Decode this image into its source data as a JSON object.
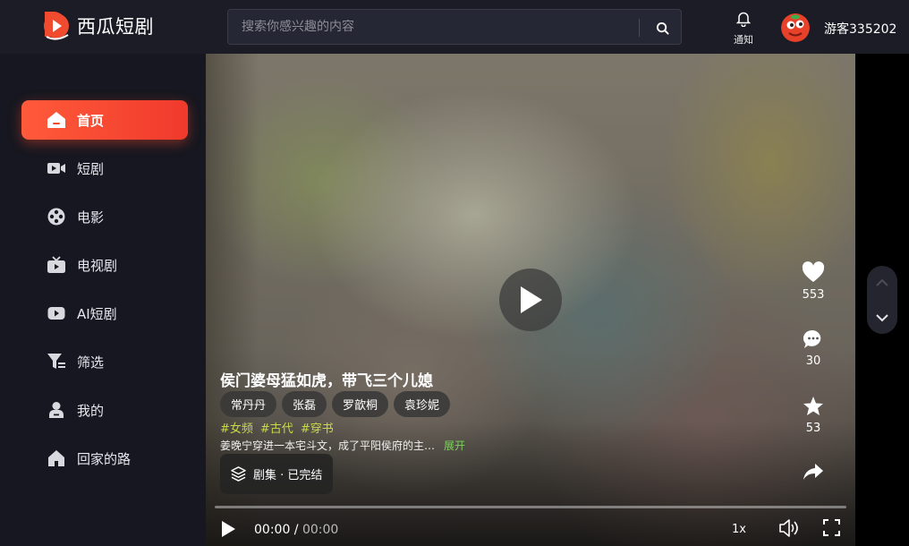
{
  "app": {
    "logo_text": "西瓜短剧"
  },
  "search": {
    "placeholder": "搜索你感兴趣的内容"
  },
  "header": {
    "notify_label": "通知",
    "username": "游客335202"
  },
  "sidebar": {
    "items": [
      {
        "label": "首页",
        "icon": "home-icon",
        "active": true
      },
      {
        "label": "短剧",
        "icon": "video-camera-icon"
      },
      {
        "label": "电影",
        "icon": "film-reel-icon"
      },
      {
        "label": "电视剧",
        "icon": "tv-icon"
      },
      {
        "label": "AI短剧",
        "icon": "play-box-icon"
      },
      {
        "label": "筛选",
        "icon": "filter-icon"
      },
      {
        "label": "我的",
        "icon": "user-icon"
      },
      {
        "label": "回家的路",
        "icon": "house-icon"
      }
    ]
  },
  "video": {
    "title": "侯门婆母猛如虎，带飞三个儿媳",
    "actors": [
      "常丹丹",
      "张磊",
      "罗歆桐",
      "袁珍妮"
    ],
    "tags": [
      "#女频",
      "#古代",
      "#穿书"
    ],
    "description": "姜晚宁穿进一本宅斗文，成了平阳侯府的主…",
    "expand_label": "展开",
    "episodes_label": "剧集 · 已完结",
    "likes": "553",
    "comments": "30",
    "favorites": "53",
    "current_time": "00:00",
    "separator": " / ",
    "duration": "00:00",
    "speed": "1x",
    "progress": 0
  },
  "colors": {
    "accent": "#f5472e",
    "tag": "#c9d94a",
    "expand": "#7bd35a"
  }
}
